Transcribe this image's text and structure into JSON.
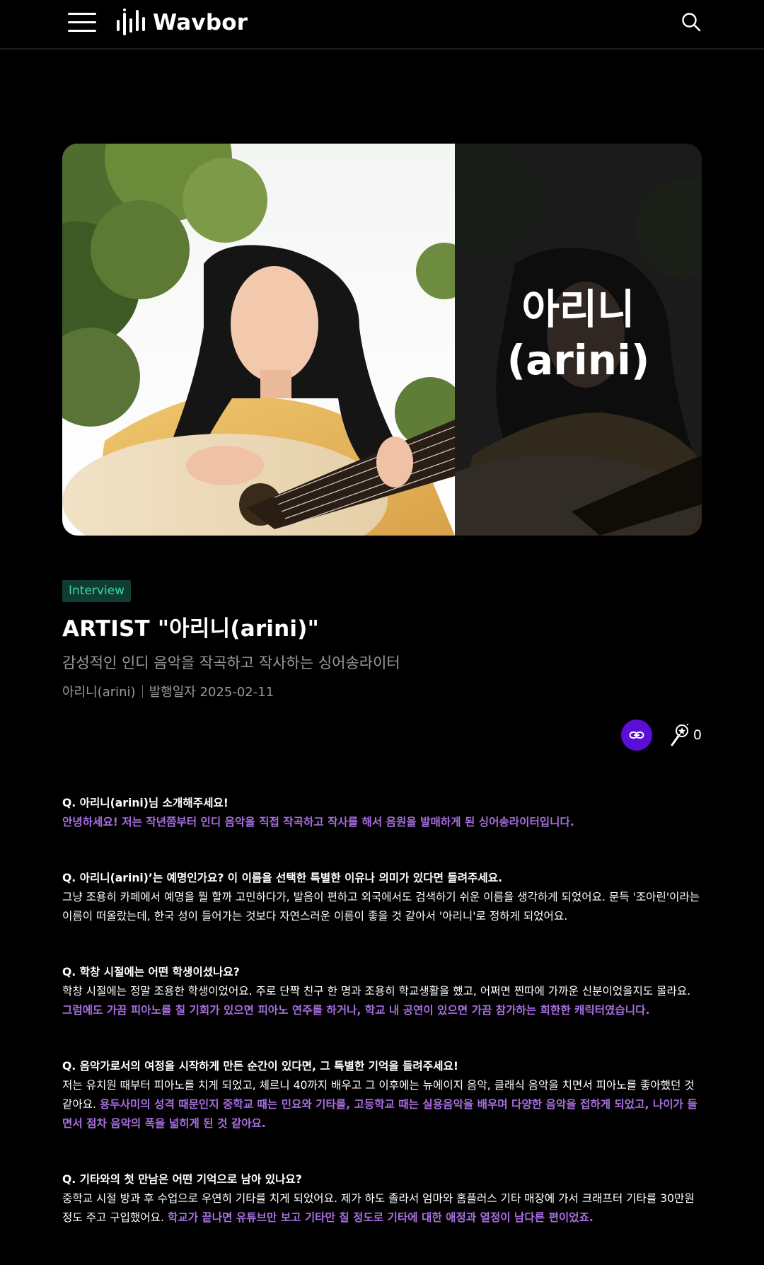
{
  "header": {
    "brand": "Wavbor"
  },
  "hero": {
    "title_line1": "아리니",
    "title_line2": "(arini)"
  },
  "article": {
    "category": "Interview",
    "title": "ARTIST \"아리니(arini)\"",
    "subtitle": "감성적인 인디 음악을 작곡하고 작사하는 싱어송라이터",
    "author": "아리니(arini)",
    "published": "발행일자 2025-02-11",
    "cheer_count": "0"
  },
  "qa": [
    {
      "question": "Q. 아리니(arini)님 소개해주세요!",
      "answer": "",
      "highlight": "안녕하세요! 저는 작년쯤부터 인디 음악을 직접 작곡하고 작사를 해서 음원을 발매하게 된 싱어송라이터입니다."
    },
    {
      "question": "Q. 아리니(arini)’는 예명인가요? 이 이름을 선택한 특별한 이유나 의미가 있다면 들려주세요.",
      "answer": "그냥 조용히 카페에서 예명을 뭘 할까 고민하다가, 발음이 편하고 외국에서도 검색하기 쉬운 이름을 생각하게 되었어요. 문득 '조아린'이라는 이름이 떠올랐는데, 한국 성이 들어가는 것보다 자연스러운 이름이 좋을 것 같아서 '아리니'로 정하게 되었어요.",
      "highlight": ""
    },
    {
      "question": "Q. 학창 시절에는 어떤 학생이셨나요?",
      "answer": "학창 시절에는 정말 조용한 학생이었어요. 주로 단짝 친구 한 명과 조용히 학교생활을 했고, 어쩌면 찐따에 가까운 신분이었을지도 몰라요. ",
      "highlight": "그럼에도 가끔 피아노를 칠 기회가 있으면 피아노 연주를 하거나, 학교 내 공연이 있으면 가끔 참가하는 희한한 캐릭터였습니다."
    },
    {
      "question": "Q. 음악가로서의 여정을 시작하게 만든 순간이 있다면, 그 특별한 기억을 들려주세요!",
      "answer": "저는 유치원 때부터 피아노를 치게 되었고, 체르니 40까지 배우고 그 이후에는 뉴에이지 음악, 클래식 음악을 치면서 피아노를 좋아했던 것 같아요. ",
      "highlight": "용두사미의 성격 때문인지 중학교 때는 민요와 기타를, 고등학교 때는 실용음악을 배우며 다양한 음악을 접하게 되었고, 나이가 들면서 점차 음악의 폭을 넓히게 된 것 같아요."
    },
    {
      "question": "Q. 기타와의 첫 만남은 어떤 기억으로 남아 있나요?",
      "answer": "중학교 시절 방과 후 수업으로 우연히 기타를 치게 되었어요. 제가 하도 졸라서 엄마와 홈플러스 기타 매장에 가서 크래프터 기타를 30만원 정도 주고 구입했어요. ",
      "highlight": "학교가 끝나면 유튜브만 보고 기타만 칠 정도로 기타에 대한 애정과 열정이 남다른 편이었죠."
    }
  ],
  "colors": {
    "background": "#000000",
    "badge_bg": "#0f3d32",
    "badge_text": "#3ad6a6",
    "link_button": "#5a0ed6",
    "highlight": "#a86ee0",
    "muted_text": "#9a9a9a"
  },
  "icons": {
    "menu": "hamburger-icon",
    "search": "search-icon",
    "share": "link-icon",
    "cheer": "lightstick-icon"
  }
}
